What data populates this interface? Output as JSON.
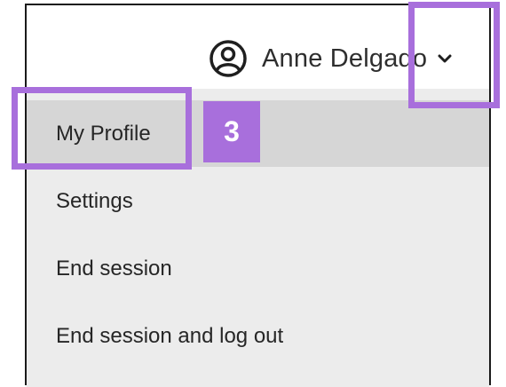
{
  "header": {
    "user_name": "Anne Delgado",
    "avatar_icon": "user-circle-icon",
    "toggle_icon": "chevron-down-icon"
  },
  "menu": {
    "items": [
      {
        "label": "My Profile",
        "active": true
      },
      {
        "label": "Settings",
        "active": false
      },
      {
        "label": "End session",
        "active": false
      },
      {
        "label": "End session and log out",
        "active": false
      }
    ]
  },
  "annotation": {
    "step_number": "3",
    "highlight_color": "#a86fdc"
  },
  "colors": {
    "menu_background": "#ececec",
    "menu_active_background": "#d6d6d6",
    "text": "#262626"
  }
}
